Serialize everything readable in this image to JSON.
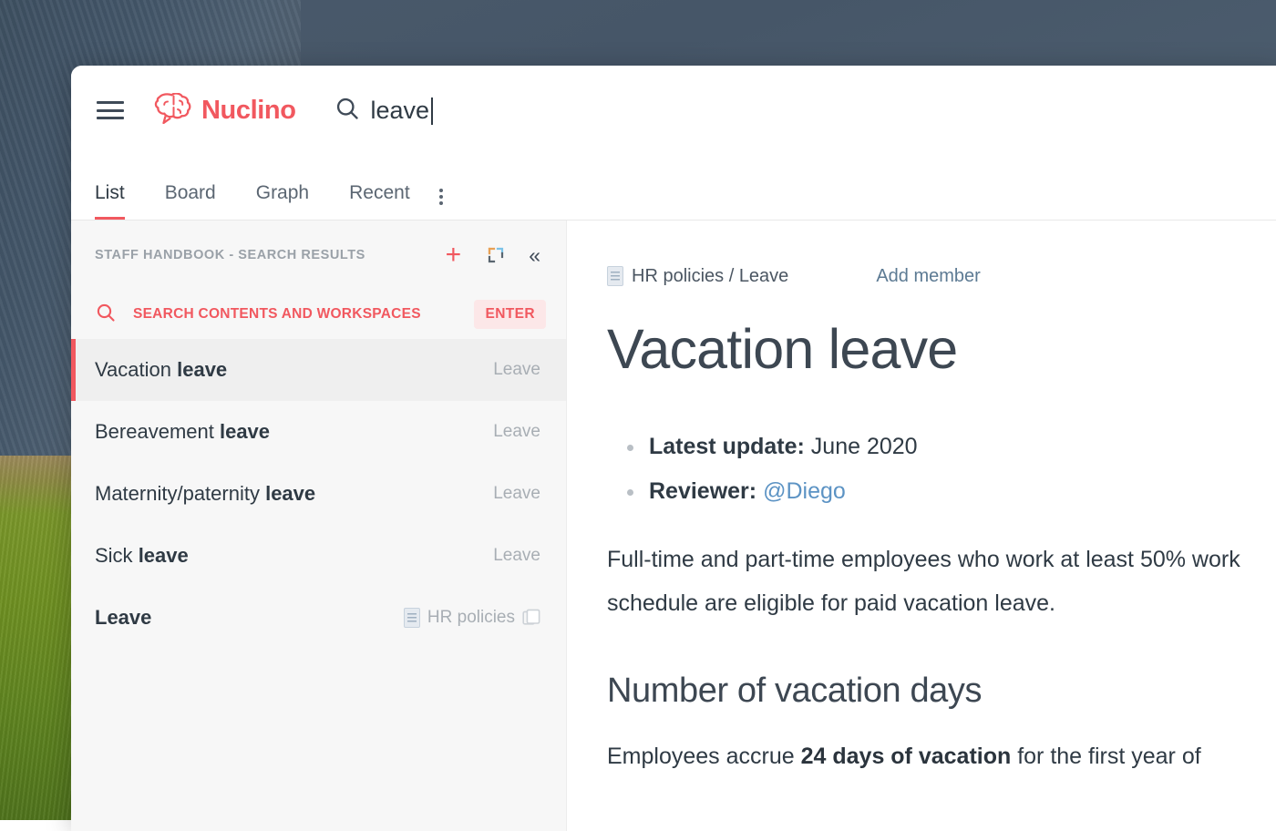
{
  "theme": {
    "accent": "#f1585f",
    "accent_soft_bg": "#fce7e8",
    "text_dark": "#2f3a44",
    "text_muted": "#9aa1a8",
    "sidebar_bg": "#f7f7f7",
    "selected_row_bg": "#efefef",
    "link_blue": "#5c93c4"
  },
  "topbar": {
    "menu_icon": "hamburger-menu-icon",
    "brand_name": "Nuclino",
    "brand_icon": "nuclino-brain-logo-icon",
    "search": {
      "icon": "search-icon",
      "value": "leave",
      "placeholder": "Search"
    }
  },
  "tabs": {
    "items": [
      {
        "label": "List",
        "active": true
      },
      {
        "label": "Board",
        "active": false
      },
      {
        "label": "Graph",
        "active": false
      },
      {
        "label": "Recent",
        "active": false
      }
    ],
    "more_icon": "more-vertical-icon"
  },
  "sidebar": {
    "title": "STAFF HANDBOOK - SEARCH RESULTS",
    "actions": [
      {
        "name": "add-item-button",
        "icon": "plus-icon",
        "label": "+"
      },
      {
        "name": "expand-sidebar-button",
        "icon": "expand-icon"
      },
      {
        "name": "collapse-sidebar-button",
        "icon": "chevron-double-left-icon",
        "label": "«"
      }
    ],
    "search_row": {
      "icon": "search-icon",
      "label": "SEARCH CONTENTS AND WORKSPACES",
      "badge": "ENTER"
    },
    "results": [
      {
        "prefix": "Vacation ",
        "match": "leave",
        "suffix": "",
        "meta": "Leave",
        "meta_icon": "",
        "trailing_icon": "",
        "selected": true
      },
      {
        "prefix": "Bereavement ",
        "match": "leave",
        "suffix": "",
        "meta": "Leave",
        "meta_icon": "",
        "trailing_icon": "",
        "selected": false
      },
      {
        "prefix": "Maternity/paternity ",
        "match": "leave",
        "suffix": "",
        "meta": "Leave",
        "meta_icon": "",
        "trailing_icon": "",
        "selected": false
      },
      {
        "prefix": "Sick ",
        "match": "leave",
        "suffix": "",
        "meta": "Leave",
        "meta_icon": "",
        "trailing_icon": "",
        "selected": false
      },
      {
        "prefix": "",
        "match": "Leave",
        "suffix": "",
        "meta": "HR policies",
        "meta_icon": "document-icon",
        "trailing_icon": "copy-icon",
        "selected": false
      }
    ]
  },
  "content": {
    "breadcrumb": {
      "icon": "document-icon",
      "text": "HR policies / Leave"
    },
    "add_member_label": "Add member",
    "title": "Vacation leave",
    "bullets": [
      {
        "label": "Latest update:",
        "value": " June 2020",
        "link": ""
      },
      {
        "label": "Reviewer:",
        "value": "",
        "link": "@Diego"
      }
    ],
    "paragraph": "Full-time and part-time employees who work at least 50% work schedule are eligible for paid vacation leave.",
    "section_heading": "Number of vacation days",
    "section_paragraph_pre": "Employees accrue ",
    "section_paragraph_bold": "24 days of vacation",
    "section_paragraph_post": " for the first year of"
  }
}
